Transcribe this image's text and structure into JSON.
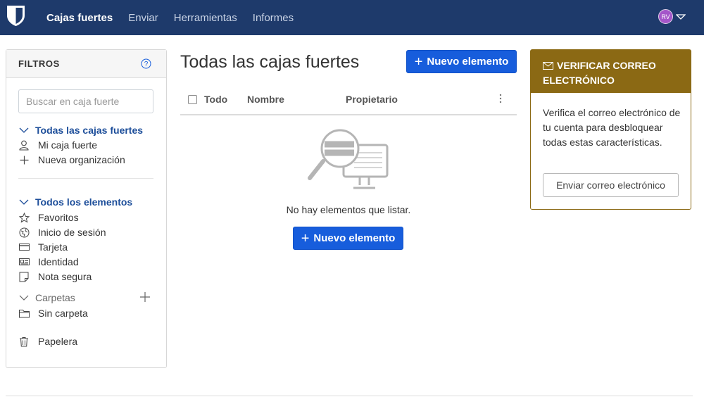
{
  "nav": {
    "links": [
      "Cajas fuertes",
      "Enviar",
      "Herramientas",
      "Informes"
    ],
    "user_initials": "RV"
  },
  "filters": {
    "title": "FILTROS",
    "search_placeholder": "Buscar en caja fuerte",
    "vaults_header": "Todas las cajas fuertes",
    "my_vault": "Mi caja fuerte",
    "new_org": "Nueva organización",
    "items_header": "Todos los elementos",
    "favorites": "Favoritos",
    "login": "Inicio de sesión",
    "card": "Tarjeta",
    "identity": "Identidad",
    "secure_note": "Nota segura",
    "folders": "Carpetas",
    "no_folder": "Sin carpeta",
    "trash": "Papelera"
  },
  "main": {
    "title": "Todas las cajas fuertes",
    "new_item": "Nuevo elemento",
    "col_all": "Todo",
    "col_name": "Nombre",
    "col_owner": "Propietario",
    "empty_text": "No hay elementos que listar."
  },
  "verify": {
    "title": "VERIFICAR CORREO ELECTRÓNICO",
    "body": "Verifica el correo electrónico de tu cuenta para desbloquear todas estas características.",
    "button": "Enviar correo electrónico"
  },
  "colors": {
    "navbar": "#1e3a6b",
    "primary": "#175ddc",
    "warning": "#8b6914"
  }
}
